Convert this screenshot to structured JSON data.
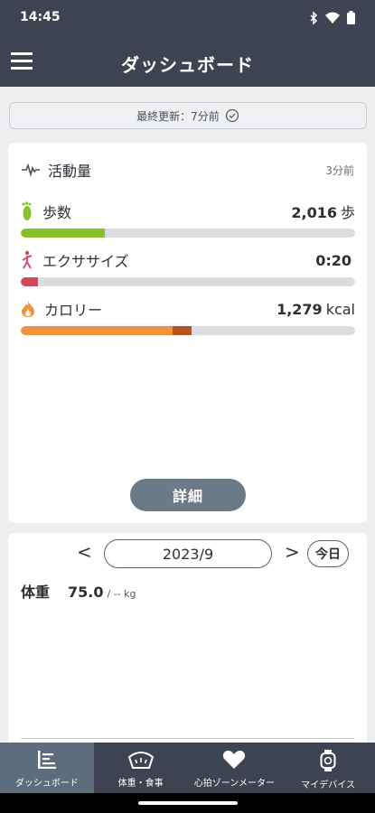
{
  "status": {
    "time": "14:45"
  },
  "header": {
    "title": "ダッシュボード"
  },
  "update_banner": {
    "text": "最終更新：7分前"
  },
  "activity": {
    "title": "活動量",
    "updated": "3分前",
    "metrics": [
      {
        "label": "歩数",
        "value": "2,016",
        "unit": "歩",
        "progress": 0.25,
        "color": "#88c22a"
      },
      {
        "label": "エクササイズ",
        "value": "0:20",
        "unit": "",
        "progress": 0.05,
        "color": "#d2485e"
      },
      {
        "label": "カロリー",
        "value": "1,279",
        "unit": "kcal",
        "progress": 0.51,
        "color": "#f0923e",
        "accent_color": "#b8501f"
      }
    ],
    "detail_button": "詳細"
  },
  "weight_card": {
    "date": "2023/9",
    "today_button": "今日",
    "weight_label": "体重",
    "weight_value": "75.0",
    "target_text": "/ -- kg"
  },
  "tabs": [
    {
      "label": "ダッシュボード",
      "icon": "dashboard-icon",
      "active": true
    },
    {
      "label": "体重・食事",
      "icon": "scale-icon",
      "active": false
    },
    {
      "label": "心拍ゾーンメーター",
      "icon": "heart-icon",
      "active": false
    },
    {
      "label": "マイデバイス",
      "icon": "watch-icon",
      "active": false
    }
  ]
}
